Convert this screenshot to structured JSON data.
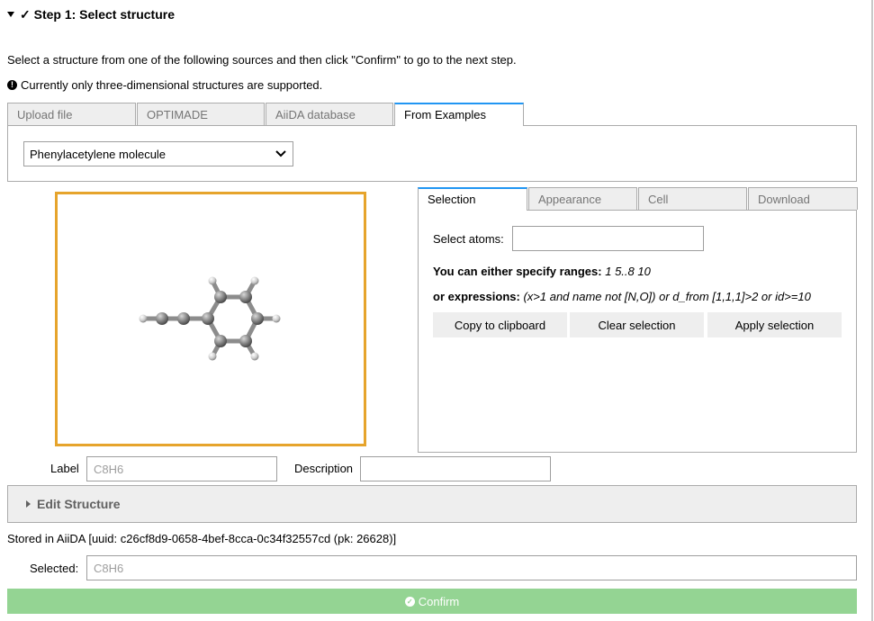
{
  "step": {
    "title": "✓ Step 1: Select structure"
  },
  "intro": "Select a structure from one of the following sources and then click \"Confirm\" to go to the next step.",
  "notice": "Currently only three-dimensional structures are supported.",
  "source_tabs": [
    "Upload file",
    "OPTIMADE",
    "AiiDA database",
    "From Examples"
  ],
  "example_select": {
    "value": "Phenylacetylene molecule"
  },
  "viewer_tabs": [
    "Selection",
    "Appearance",
    "Cell",
    "Download"
  ],
  "selection": {
    "select_atoms_label": "Select atoms:",
    "select_atoms_value": "",
    "ranges_label": "You can either specify ranges:",
    "ranges_example": "1 5..8 10",
    "expr_label": "or expressions:",
    "expr_example": "(x>1 and name not [N,O]) or d_from [1,1,1]>2 or id>=10",
    "buttons": [
      "Copy to clipboard",
      "Clear selection",
      "Apply selection"
    ]
  },
  "label_field": {
    "label": "Label",
    "placeholder": "C8H6"
  },
  "description_field": {
    "label": "Description",
    "value": ""
  },
  "edit_structure": "Edit Structure",
  "stored": "Stored in AiiDA [uuid: c26cf8d9-0658-4bef-8cca-0c34f32557cd (pk: 26628)]",
  "selected": {
    "label": "Selected:",
    "placeholder": "C8H6"
  },
  "confirm_label": "Confirm",
  "colors": {
    "accent": "#2196f3",
    "viewer_border": "#e6a42c",
    "confirm_bg": "#94d493",
    "tab_bg": "#eeeeee"
  },
  "icons": [
    "caret-down-icon",
    "exclamation-circle-icon",
    "chevron-down-icon",
    "caret-right-icon",
    "check-circle-icon"
  ]
}
